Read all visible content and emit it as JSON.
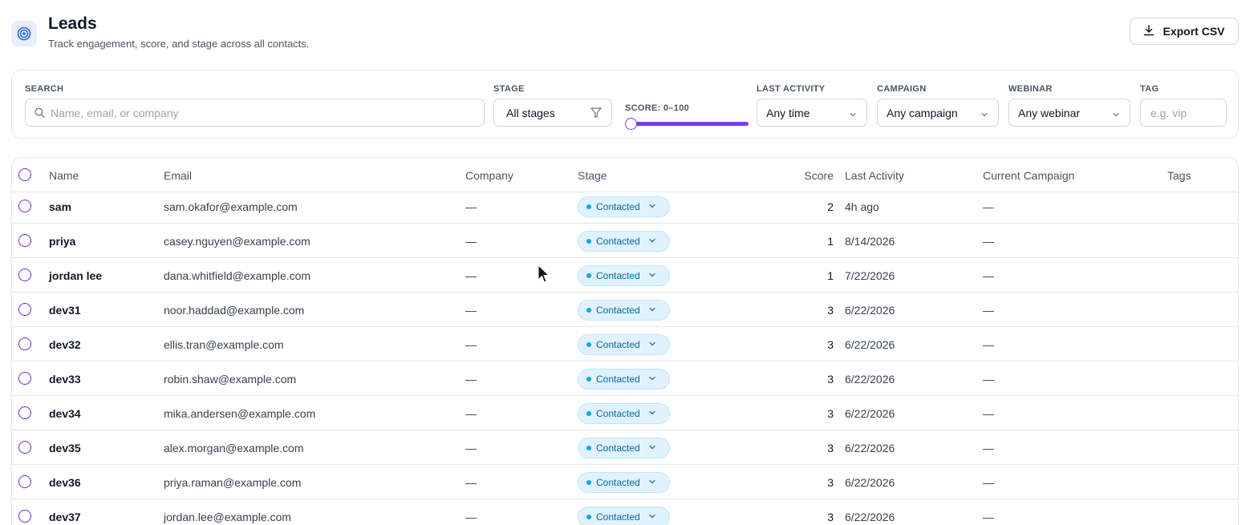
{
  "header": {
    "title": "Leads",
    "subtitle": "Track engagement, score, and stage across all contacts.",
    "export_label": "Export CSV"
  },
  "filters": {
    "search": {
      "label": "SEARCH",
      "placeholder": "Name, email, or company"
    },
    "stage": {
      "label": "STAGE",
      "value": "All stages"
    },
    "score": {
      "label": "SCORE: 0–100",
      "min": 0,
      "max": 100
    },
    "last_activity": {
      "label": "LAST ACTIVITY",
      "value": "Any time"
    },
    "campaign": {
      "label": "CAMPAIGN",
      "value": "Any campaign"
    },
    "webinar": {
      "label": "WEBINAR",
      "value": "Any webinar"
    },
    "tag": {
      "label": "TAG",
      "placeholder": "e.g. vip"
    }
  },
  "table": {
    "columns": {
      "name": "Name",
      "email": "Email",
      "company": "Company",
      "stage": "Stage",
      "score": "Score",
      "last_activity": "Last Activity",
      "campaign": "Current Campaign",
      "tags": "Tags"
    },
    "rows": [
      {
        "name": "sam",
        "email": "sam.okafor@example.com",
        "company": "—",
        "stage": "Contacted",
        "score": "2",
        "last_activity": "4h ago",
        "campaign": "—",
        "tags": ""
      },
      {
        "name": "priya",
        "email": "casey.nguyen@example.com",
        "company": "—",
        "stage": "Contacted",
        "score": "1",
        "last_activity": "8/14/2026",
        "campaign": "—",
        "tags": ""
      },
      {
        "name": "jordan lee",
        "email": "dana.whitfield@example.com",
        "company": "—",
        "stage": "Contacted",
        "score": "1",
        "last_activity": "7/22/2026",
        "campaign": "—",
        "tags": ""
      },
      {
        "name": "dev31",
        "email": "noor.haddad@example.com",
        "company": "—",
        "stage": "Contacted",
        "score": "3",
        "last_activity": "6/22/2026",
        "campaign": "—",
        "tags": ""
      },
      {
        "name": "dev32",
        "email": "ellis.tran@example.com",
        "company": "—",
        "stage": "Contacted",
        "score": "3",
        "last_activity": "6/22/2026",
        "campaign": "—",
        "tags": ""
      },
      {
        "name": "dev33",
        "email": "robin.shaw@example.com",
        "company": "—",
        "stage": "Contacted",
        "score": "3",
        "last_activity": "6/22/2026",
        "campaign": "—",
        "tags": ""
      },
      {
        "name": "dev34",
        "email": "mika.andersen@example.com",
        "company": "—",
        "stage": "Contacted",
        "score": "3",
        "last_activity": "6/22/2026",
        "campaign": "—",
        "tags": ""
      },
      {
        "name": "dev35",
        "email": "alex.morgan@example.com",
        "company": "—",
        "stage": "Contacted",
        "score": "3",
        "last_activity": "6/22/2026",
        "campaign": "—",
        "tags": ""
      },
      {
        "name": "dev36",
        "email": "priya.raman@example.com",
        "company": "—",
        "stage": "Contacted",
        "score": "3",
        "last_activity": "6/22/2026",
        "campaign": "—",
        "tags": ""
      },
      {
        "name": "dev37",
        "email": "jordan.lee@example.com",
        "company": "—",
        "stage": "Contacted",
        "score": "3",
        "last_activity": "6/22/2026",
        "campaign": "—",
        "tags": ""
      }
    ]
  },
  "colors": {
    "accent": "#7c3aed",
    "stage_pill_bg": "#e0f2fe",
    "stage_pill_text": "#0369a1"
  },
  "icons": {
    "app": "target-icon",
    "export": "download-icon",
    "search": "search-icon",
    "stage_filter": "filter-icon",
    "dropdown": "chevron-down-icon"
  }
}
